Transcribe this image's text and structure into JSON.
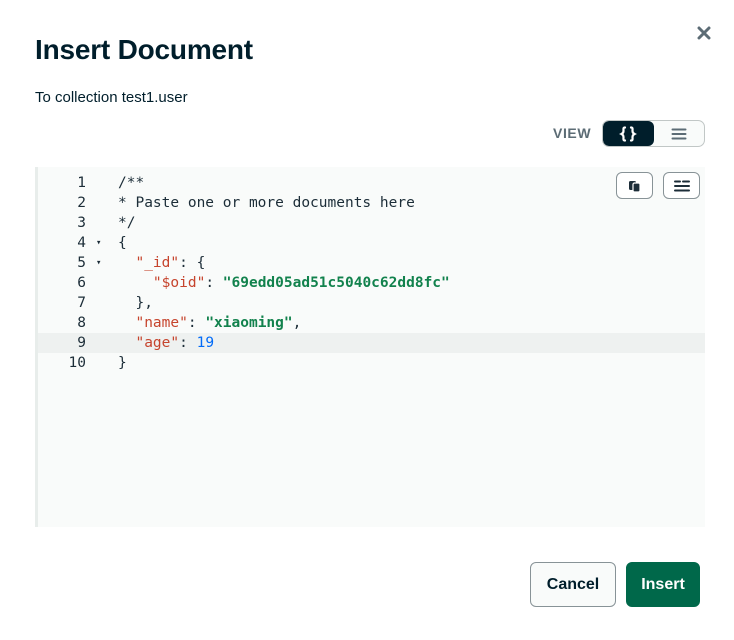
{
  "dialog": {
    "title": "Insert Document",
    "subtitle": "To collection test1.user",
    "close_icon": "close-icon"
  },
  "view": {
    "label": "VIEW",
    "options": [
      {
        "icon": "json-braces-icon",
        "glyph": "{}",
        "selected": true
      },
      {
        "icon": "list-icon",
        "glyph": "≡",
        "selected": false
      }
    ]
  },
  "editor": {
    "toolbar": [
      {
        "icon": "copy-icon"
      },
      {
        "icon": "format-icon"
      }
    ],
    "active_line": 9,
    "lines": [
      {
        "n": "1",
        "fold": "",
        "tokens": [
          {
            "t": "comment",
            "v": "/**"
          }
        ]
      },
      {
        "n": "2",
        "fold": "",
        "tokens": [
          {
            "t": "comment",
            "v": "* Paste one or more documents here"
          }
        ]
      },
      {
        "n": "3",
        "fold": "",
        "tokens": [
          {
            "t": "comment",
            "v": "*/"
          }
        ]
      },
      {
        "n": "4",
        "fold": "▾",
        "tokens": [
          {
            "t": "punct",
            "v": "{"
          }
        ]
      },
      {
        "n": "5",
        "fold": "▾",
        "tokens": [
          {
            "t": "punct",
            "v": "  "
          },
          {
            "t": "key",
            "v": "\"_id\""
          },
          {
            "t": "punct",
            "v": ": {"
          }
        ]
      },
      {
        "n": "6",
        "fold": "",
        "tokens": [
          {
            "t": "punct",
            "v": "    "
          },
          {
            "t": "key",
            "v": "\"$oid\""
          },
          {
            "t": "punct",
            "v": ": "
          },
          {
            "t": "str",
            "v": "\"69edd05ad51c5040c62dd8fc\""
          }
        ]
      },
      {
        "n": "7",
        "fold": "",
        "tokens": [
          {
            "t": "punct",
            "v": "  },"
          }
        ]
      },
      {
        "n": "8",
        "fold": "",
        "tokens": [
          {
            "t": "punct",
            "v": "  "
          },
          {
            "t": "key",
            "v": "\"name\""
          },
          {
            "t": "punct",
            "v": ": "
          },
          {
            "t": "str",
            "v": "\"xiaoming\""
          },
          {
            "t": "punct",
            "v": ","
          }
        ]
      },
      {
        "n": "9",
        "fold": "",
        "tokens": [
          {
            "t": "punct",
            "v": "  "
          },
          {
            "t": "key",
            "v": "\"age\""
          },
          {
            "t": "punct",
            "v": ": "
          },
          {
            "t": "num",
            "v": "19"
          }
        ]
      },
      {
        "n": "10",
        "fold": "",
        "tokens": [
          {
            "t": "punct",
            "v": "}"
          }
        ]
      }
    ]
  },
  "footer": {
    "cancel_label": "Cancel",
    "insert_label": "Insert"
  },
  "colors": {
    "primary_button": "#00684a",
    "toggle_active": "#001e2b",
    "json_key": "#c6442d",
    "json_string": "#12824d",
    "json_number": "#016bf8"
  }
}
